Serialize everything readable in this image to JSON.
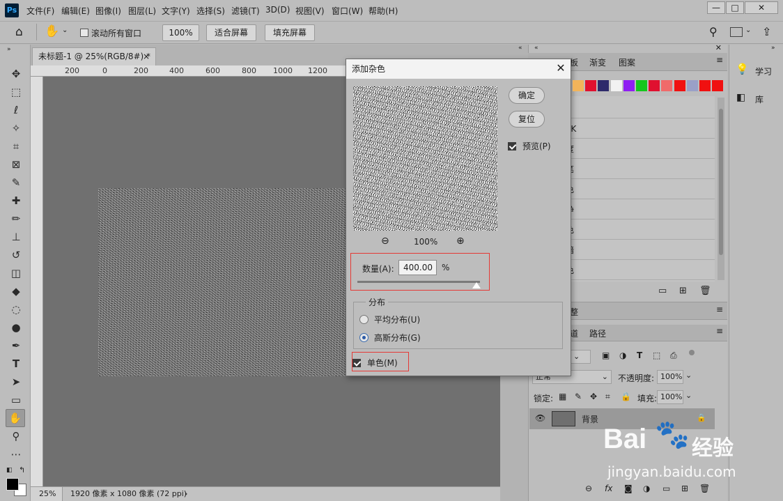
{
  "app": {
    "logo_text": "Ps"
  },
  "menu": [
    "文件(F)",
    "编辑(E)",
    "图像(I)",
    "图层(L)",
    "文字(Y)",
    "选择(S)",
    "滤镜(T)",
    "3D(D)",
    "视图(V)",
    "窗口(W)",
    "帮助(H)"
  ],
  "window_controls": {
    "minimize": "—",
    "maximize": "□",
    "close": "✕"
  },
  "options": {
    "scroll_all_label": "滚动所有窗口",
    "zoom_100": "100%",
    "fit_screen": "适合屏幕",
    "fill_screen": "填充屏幕"
  },
  "document": {
    "tab_title": "未标题-1 @ 25%(RGB/8#) *",
    "tab_close": "×",
    "ruler_labels": [
      "200",
      "0",
      "200",
      "400",
      "600",
      "800",
      "1000",
      "1200"
    ],
    "zoom": "25%",
    "info": "1920 像素 x 1080 像素 (72 ppi)",
    "info_arrow": "›"
  },
  "panels": {
    "tabs": [
      "板",
      "渐变",
      "图案"
    ],
    "swatch_colors": [
      "#f2b45a",
      "#e0102f",
      "#2d2a6b",
      "#f2f2f2",
      "#8f1ff2",
      "#15c71d",
      "#e0102f",
      "#f06a6a",
      "#f01010",
      "#9aa0c8",
      "#f01010",
      "#f01010"
    ],
    "list_items": [
      "B",
      "YK",
      "度",
      "笔",
      "色",
      "净",
      "色",
      "暗",
      "色"
    ],
    "section2_label": "整",
    "layer_tabs": [
      "道",
      "路径"
    ],
    "blend_mode": "正常",
    "opacity_label": "不透明度:",
    "opacity_value": "100%",
    "lock_label": "锁定:",
    "fill_label": "填充:",
    "fill_value": "100%",
    "layer_name": "背景",
    "bottom_icons": [
      "link-icon",
      "fx-icon",
      "mask-icon",
      "adjust-icon",
      "folder-icon",
      "new-layer-icon",
      "trash-icon"
    ]
  },
  "far_right": {
    "learn": "学习",
    "library": "库"
  },
  "dialog": {
    "title": "添加杂色",
    "ok": "确定",
    "reset": "复位",
    "preview_label": "预览(P)",
    "zoom_value": "100%",
    "amount_label": "数量(A):",
    "amount_value": "400.00",
    "amount_unit": "%",
    "amount_slider_fraction": 0.97,
    "distribution_label": "分布",
    "uniform_label": "平均分布(U)",
    "gaussian_label": "高斯分布(G)",
    "mono_label": "单色(M)",
    "selected_distribution": "gaussian"
  },
  "watermark": {
    "brand": "Bai",
    "brand_cn": "经验",
    "url": "jingyan.baidu.com"
  }
}
